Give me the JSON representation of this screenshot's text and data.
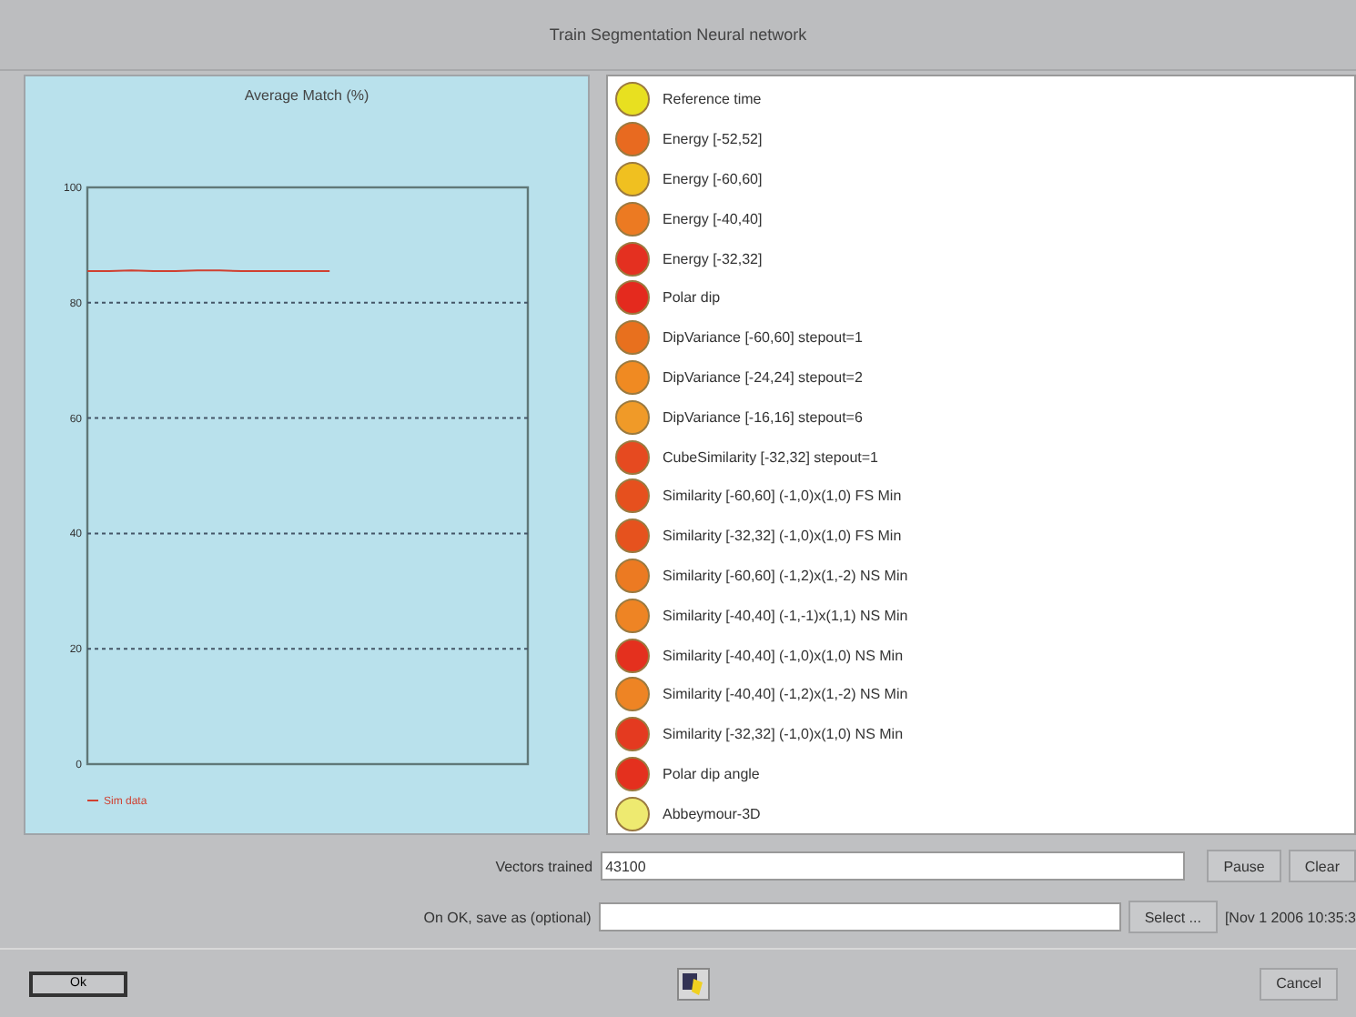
{
  "window": {
    "title": "Train Segmentation Neural network"
  },
  "chart": {
    "chart_data": {
      "type": "line",
      "title": "Average Match (%)",
      "categories": [
        null,
        null,
        null,
        null,
        null,
        null,
        null,
        null,
        null,
        null,
        null,
        null,
        null,
        null,
        null,
        null,
        null,
        null,
        null,
        null,
        null
      ],
      "ylim": [
        0,
        100
      ],
      "grid": true,
      "yticks": [
        {
          "value": 0,
          "label": "0"
        },
        {
          "value": 20,
          "label": "20"
        },
        {
          "value": 40,
          "label": "40"
        },
        {
          "value": 60,
          "label": "60"
        },
        {
          "value": 80,
          "label": "80"
        },
        {
          "value": 100,
          "label": "100"
        }
      ],
      "series": [
        {
          "name": "Sim data",
          "color": "#d04030",
          "values": [
            85.5,
            85.5,
            85.6,
            85.5,
            85.5,
            85.6,
            85.6,
            85.5,
            85.5,
            85.5,
            85.5,
            85.5,
            null,
            null,
            null,
            null,
            null,
            null,
            null,
            null,
            null
          ]
        }
      ]
    }
  },
  "attributes": [
    {
      "label": "Reference time",
      "color": "#e8e020"
    },
    {
      "label": "Energy [-52,52]",
      "color": "#e86a20"
    },
    {
      "label": "Energy [-60,60]",
      "color": "#f0c020"
    },
    {
      "label": "Energy [-40,40]",
      "color": "#ec7a22"
    },
    {
      "label": "Energy [-32,32]",
      "color": "#e43020"
    },
    {
      "label": "Polar dip",
      "color": "#e42a1e"
    },
    {
      "label": "DipVariance [-60,60] stepout=1",
      "color": "#e8701e"
    },
    {
      "label": "DipVariance [-24,24] stepout=2",
      "color": "#f08a22"
    },
    {
      "label": "DipVariance [-16,16] stepout=6",
      "color": "#f09a28"
    },
    {
      "label": "CubeSimilarity [-32,32] stepout=1",
      "color": "#e64a20"
    },
    {
      "label": "Similarity [-60,60] (-1,0)x(1,0) FS Min",
      "color": "#e6501e"
    },
    {
      "label": "Similarity [-32,32] (-1,0)x(1,0) FS Min",
      "color": "#e6521e"
    },
    {
      "label": "Similarity [-60,60] (-1,2)x(1,-2) NS Min",
      "color": "#ec7a22"
    },
    {
      "label": "Similarity [-40,40] (-1,-1)x(1,1) NS Min",
      "color": "#ee8424"
    },
    {
      "label": "Similarity [-40,40] (-1,0)x(1,0) NS Min",
      "color": "#e4301e"
    },
    {
      "label": "Similarity [-40,40] (-1,2)x(1,-2) NS Min",
      "color": "#ee8424"
    },
    {
      "label": "Similarity [-32,32] (-1,0)x(1,0) NS Min",
      "color": "#e43a20"
    },
    {
      "label": "Polar dip angle",
      "color": "#e4301e"
    },
    {
      "label": "Abbeymour-3D",
      "color": "#eeea70"
    }
  ],
  "vectors": {
    "label": "Vectors trained",
    "value": "43100",
    "buttons": [
      "Pause",
      "Clear"
    ]
  },
  "save": {
    "label": "On OK, save as (optional)",
    "button": "Select ...",
    "timestamp": "[Nov 1 2006 10:35:3"
  },
  "footer": {
    "ok": "Ok",
    "cancel": "Cancel"
  }
}
